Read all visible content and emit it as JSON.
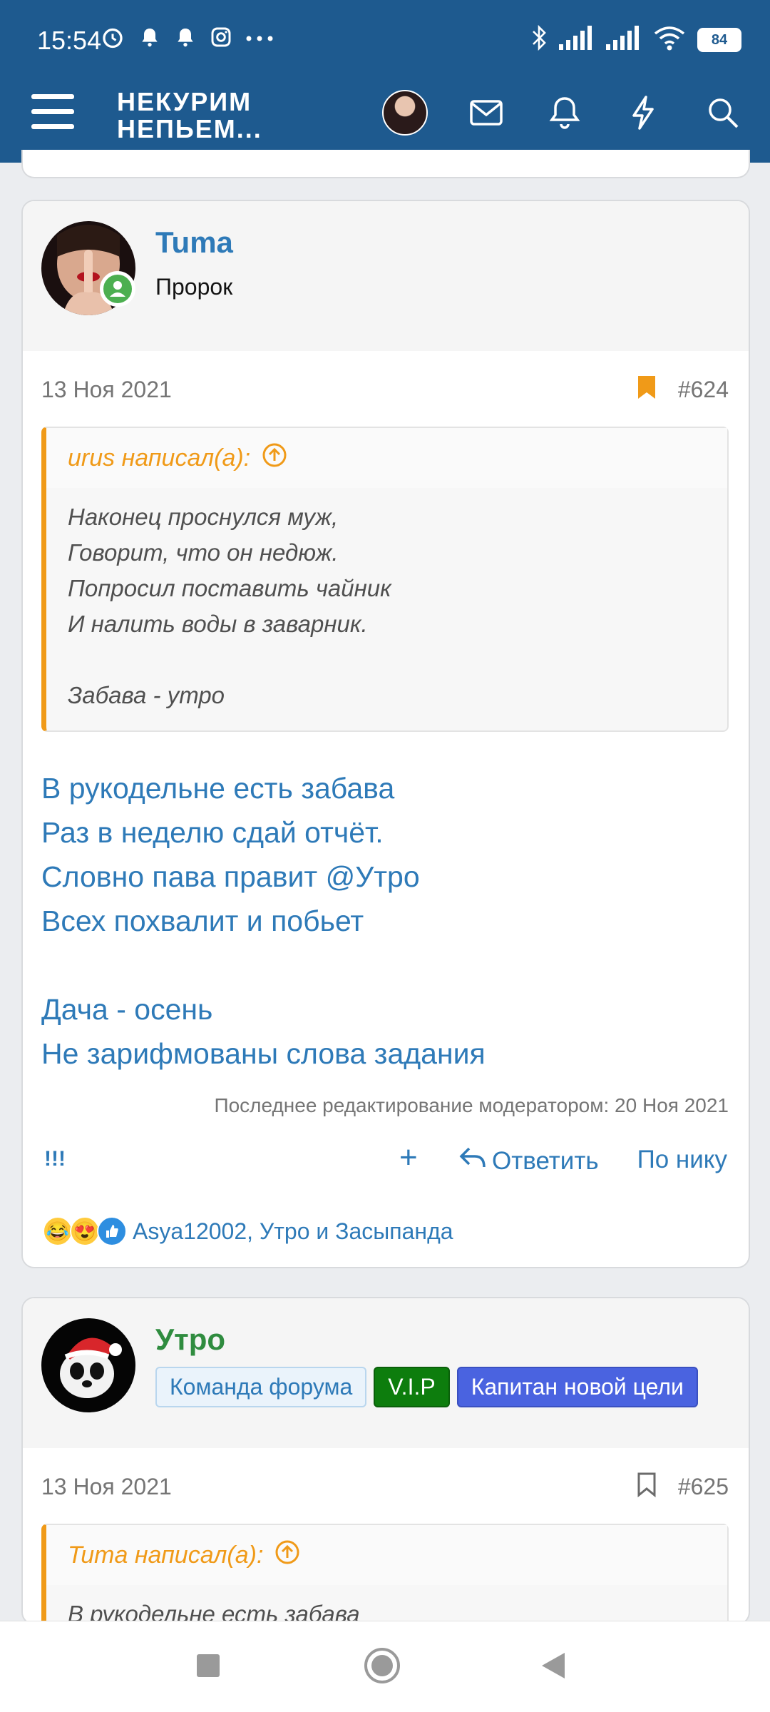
{
  "status_bar": {
    "time": "15:54",
    "battery": "84"
  },
  "header": {
    "logo_line1": "НЕКУРИМ",
    "logo_line2": "НЕПЬЕМ..."
  },
  "posts": [
    {
      "username": "Tuma",
      "user_title": "Пророк",
      "date": "13 Ноя 2021",
      "number": "#624",
      "quote_author": "urus написал(а):",
      "quote_text": "Наконец проснулся муж,\nГоворит, что он недюж.\nПопросил поставить чайник\nИ налить воды в заварник.\n\nЗабава - утро",
      "body": "В рукодельне есть забава\nРаз в неделю сдай отчёт.\nСловно пава правит @Утро\nВсех похвалит и побьет\n\nДача - осень\nНе зарифмованы слова задания",
      "edited": "Последнее редактирование модератором: 20 Ноя 2021",
      "actions": {
        "bang": "!!!",
        "plus": "+",
        "reply": "Ответить",
        "by_nick": "По нику"
      },
      "reactions": "Asya12002, Утро и Засыпанда",
      "username_color": "#2e7ab8",
      "bookmark_color": "#f09a18"
    },
    {
      "username": "Утро",
      "badges": [
        {
          "label": "Команда форума",
          "bg": "#eaf3fb",
          "fg": "#2e7ab8",
          "border": "#b9d6ee"
        },
        {
          "label": "V.I.P",
          "bg": "#0d7d0d",
          "fg": "#ffffff",
          "border": "#0a5f0a"
        },
        {
          "label": "Капитан новой цели",
          "bg": "#4a63e0",
          "fg": "#ffffff",
          "border": "#3a50c0"
        }
      ],
      "date": "13 Ноя 2021",
      "number": "#625",
      "quote_author": "Tuma написал(а):",
      "quote_text": "В рукодельне есть забава",
      "username_color": "#2f8c3f"
    }
  ]
}
